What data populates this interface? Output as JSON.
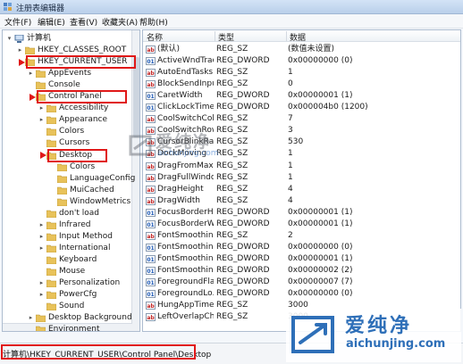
{
  "window": {
    "title": "注册表编辑器"
  },
  "menu": [
    "文件(F)",
    "编辑(E)",
    "查看(V)",
    "收藏夹(A)",
    "帮助(H)"
  ],
  "tree": [
    {
      "label": "计算机",
      "level": 0,
      "toggle": "▾",
      "highlight": false
    },
    {
      "label": "HKEY_CLASSES_ROOT",
      "level": 1,
      "toggle": "▸",
      "highlight": false
    },
    {
      "label": "HKEY_CURRENT_USER",
      "level": 1,
      "toggle": "▾",
      "highlight": true
    },
    {
      "label": "AppEvents",
      "level": 2,
      "toggle": "▸",
      "highlight": false
    },
    {
      "label": "Console",
      "level": 2,
      "toggle": "",
      "highlight": false
    },
    {
      "label": "Control Panel",
      "level": 2,
      "toggle": "▾",
      "highlight": true
    },
    {
      "label": "Accessibility",
      "level": 3,
      "toggle": "▸",
      "highlight": false
    },
    {
      "label": "Appearance",
      "level": 3,
      "toggle": "▸",
      "highlight": false
    },
    {
      "label": "Colors",
      "level": 3,
      "toggle": "",
      "highlight": false
    },
    {
      "label": "Cursors",
      "level": 3,
      "toggle": "",
      "highlight": false
    },
    {
      "label": "Desktop",
      "level": 3,
      "toggle": "▾",
      "highlight": true
    },
    {
      "label": "Colors",
      "level": 4,
      "toggle": "",
      "highlight": false
    },
    {
      "label": "LanguageConfig",
      "level": 4,
      "toggle": "",
      "highlight": false
    },
    {
      "label": "MuiCached",
      "level": 4,
      "toggle": "",
      "highlight": false
    },
    {
      "label": "WindowMetrics",
      "level": 4,
      "toggle": "",
      "highlight": false
    },
    {
      "label": "don't load",
      "level": 3,
      "toggle": "",
      "highlight": false
    },
    {
      "label": "Infrared",
      "level": 3,
      "toggle": "▸",
      "highlight": false
    },
    {
      "label": "Input Method",
      "level": 3,
      "toggle": "▸",
      "highlight": false
    },
    {
      "label": "International",
      "level": 3,
      "toggle": "▸",
      "highlight": false
    },
    {
      "label": "Keyboard",
      "level": 3,
      "toggle": "",
      "highlight": false
    },
    {
      "label": "Mouse",
      "level": 3,
      "toggle": "",
      "highlight": false
    },
    {
      "label": "Personalization",
      "level": 3,
      "toggle": "▸",
      "highlight": false
    },
    {
      "label": "PowerCfg",
      "level": 3,
      "toggle": "▸",
      "highlight": false
    },
    {
      "label": "Sound",
      "level": 3,
      "toggle": "",
      "highlight": false
    },
    {
      "label": "Desktop Background",
      "level": 2,
      "toggle": "▸",
      "highlight": false
    },
    {
      "label": "Environment",
      "level": 2,
      "toggle": "",
      "highlight": false
    }
  ],
  "list": {
    "columns": [
      "名称",
      "类型",
      "数据"
    ],
    "rows": [
      {
        "name": "(默认)",
        "type": "REG_SZ",
        "data": "(数值未设置)",
        "icon": "string"
      },
      {
        "name": "ActiveWndTrac...",
        "type": "REG_DWORD",
        "data": "0x00000000 (0)",
        "icon": "binary"
      },
      {
        "name": "AutoEndTasks",
        "type": "REG_SZ",
        "data": "1",
        "icon": "string"
      },
      {
        "name": "BlockSendInpu...",
        "type": "REG_SZ",
        "data": "0",
        "icon": "string"
      },
      {
        "name": "CaretWidth",
        "type": "REG_DWORD",
        "data": "0x00000001 (1)",
        "icon": "binary"
      },
      {
        "name": "ClickLockTime",
        "type": "REG_DWORD",
        "data": "0x000004b0 (1200)",
        "icon": "binary"
      },
      {
        "name": "CoolSwitchCol...",
        "type": "REG_SZ",
        "data": "7",
        "icon": "string"
      },
      {
        "name": "CoolSwitchRows",
        "type": "REG_SZ",
        "data": "3",
        "icon": "string"
      },
      {
        "name": "CursorBlinkRate",
        "type": "REG_SZ",
        "data": "530",
        "icon": "string"
      },
      {
        "name": "DockMoving",
        "type": "REG_SZ",
        "data": "1",
        "icon": "string"
      },
      {
        "name": "DragFromMaxi...",
        "type": "REG_SZ",
        "data": "1",
        "icon": "string"
      },
      {
        "name": "DragFullWindo...",
        "type": "REG_SZ",
        "data": "1",
        "icon": "string"
      },
      {
        "name": "DragHeight",
        "type": "REG_SZ",
        "data": "4",
        "icon": "string"
      },
      {
        "name": "DragWidth",
        "type": "REG_SZ",
        "data": "4",
        "icon": "string"
      },
      {
        "name": "FocusBorderH...",
        "type": "REG_DWORD",
        "data": "0x00000001 (1)",
        "icon": "binary"
      },
      {
        "name": "FocusBorderW...",
        "type": "REG_DWORD",
        "data": "0x00000001 (1)",
        "icon": "binary"
      },
      {
        "name": "FontSmoothing",
        "type": "REG_SZ",
        "data": "2",
        "icon": "string"
      },
      {
        "name": "FontSmoothin...",
        "type": "REG_DWORD",
        "data": "0x00000000 (0)",
        "icon": "binary"
      },
      {
        "name": "FontSmoothin...",
        "type": "REG_DWORD",
        "data": "0x00000001 (1)",
        "icon": "binary"
      },
      {
        "name": "FontSmoothin...",
        "type": "REG_DWORD",
        "data": "0x00000002 (2)",
        "icon": "binary"
      },
      {
        "name": "ForegroundFla...",
        "type": "REG_DWORD",
        "data": "0x00000007 (7)",
        "icon": "binary"
      },
      {
        "name": "ForegroundLo...",
        "type": "REG_DWORD",
        "data": "0x00000000 (0)",
        "icon": "binary"
      },
      {
        "name": "HungAppTime...",
        "type": "REG_SZ",
        "data": "3000",
        "icon": "string"
      },
      {
        "name": "LeftOverlapCh...",
        "type": "REG_SZ",
        "data": "3000",
        "icon": "string"
      }
    ]
  },
  "status": {
    "path": "计算机\\HKEY_CURRENT_USER\\Control Panel\\Desktop"
  },
  "watermark": {
    "center_text": "爱纯净",
    "center_url": "aichunjing.com",
    "corner_text": "爱纯净",
    "corner_url": "aichunjing.com"
  },
  "colors": {
    "highlight_box": "#e01818",
    "brand": "#2e6fb8",
    "folder": "#e8c25a"
  }
}
